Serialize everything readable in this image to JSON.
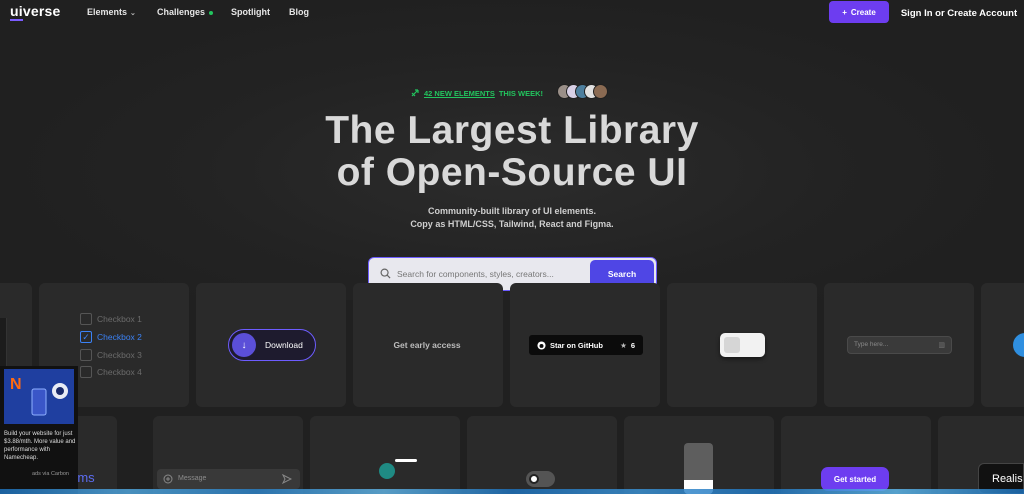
{
  "nav": {
    "logo_ui": "ui",
    "logo_rest": "verse",
    "items": [
      {
        "label": "Elements",
        "has_dropdown": true
      },
      {
        "label": "Challenges",
        "has_dot": true
      },
      {
        "label": "Spotlight"
      },
      {
        "label": "Blog"
      }
    ],
    "create_label": "Create",
    "signin_label": "Sign In or Create Account"
  },
  "hero": {
    "badge_count_link": "42 NEW ELEMENTS",
    "badge_rest": "THIS WEEK!",
    "title_line1": "The Largest Library",
    "title_line2": "of Open-Source UI",
    "subtitle_line1": "Community-built library of UI elements.",
    "subtitle_line2": "Copy as HTML/CSS, Tailwind, React and Figma."
  },
  "search": {
    "placeholder": "Search for components, styles, creators...",
    "button_label": "Search"
  },
  "cards": {
    "checkboxes": [
      "Checkbox 1",
      "Checkbox 2",
      "Checkbox 3",
      "Checkbox 4"
    ],
    "checked_index": 1,
    "download_label": "Download",
    "early_access_label": "Get early access",
    "github_label": "Star on GitHub",
    "github_stars": "6",
    "type_placeholder": "Type here...",
    "message_placeholder": "Message",
    "get_started_label": "Get started",
    "realis_label": "Realis",
    "forms_fragment": "rms"
  },
  "ad": {
    "text": "Build your website for just $3.88/mth. More value and performance with Namecheap.",
    "footer": "ads via Carbon"
  },
  "colors": {
    "accent": "#6d3df0",
    "green": "#22c55e",
    "search_button": "#4f46e5",
    "background": "#202020"
  }
}
